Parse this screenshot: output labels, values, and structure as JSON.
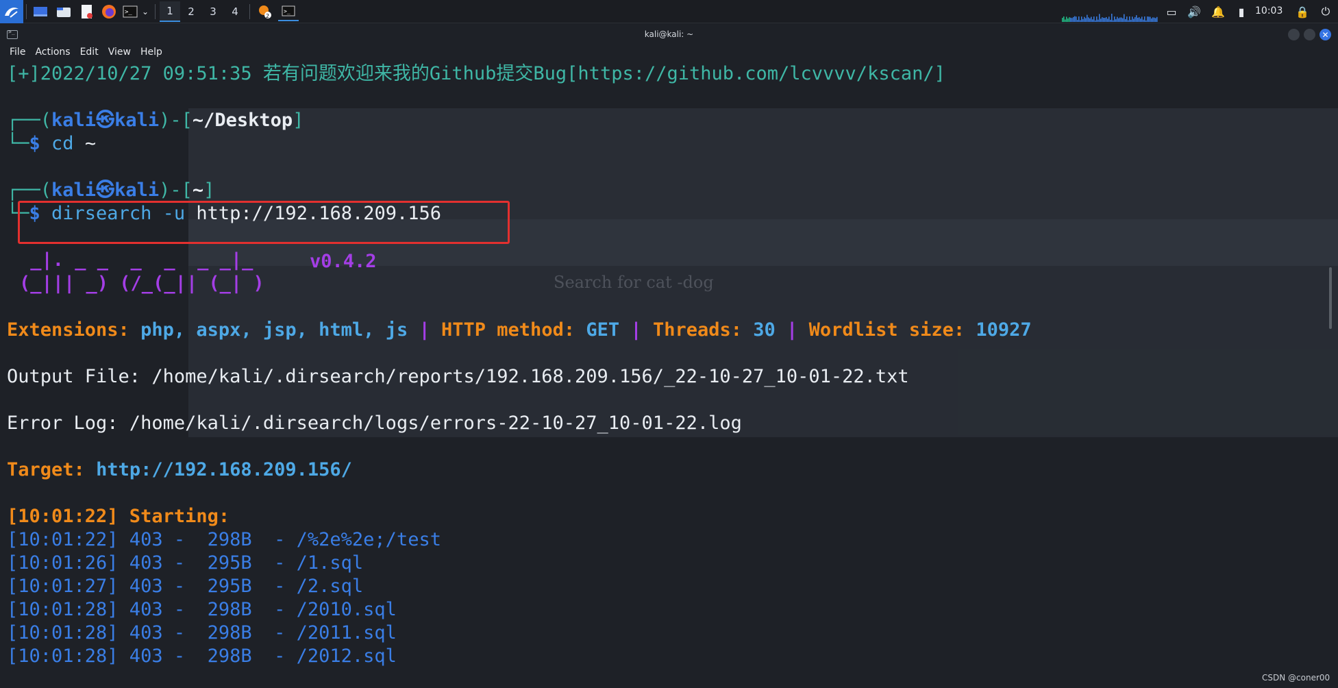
{
  "taskbar": {
    "workspaces": [
      "1",
      "2",
      "3",
      "4"
    ],
    "active_workspace": "1",
    "clock": "10:03",
    "notif_badge": "2"
  },
  "window": {
    "title": "kali@kali: ~"
  },
  "menu": [
    "File",
    "Actions",
    "Edit",
    "View",
    "Help"
  ],
  "ghost_browser": {
    "search_heading": "Search for cat -dog"
  },
  "terminal": {
    "line1": "[+]2022/10/27 09:51:35 若有问题欢迎来我的Github提交Bug[https://github.com/lcvvvv/kscan/]",
    "prompt1": {
      "user": "kali",
      "host": "kali",
      "dir": "~/Desktop",
      "cmd": "cd",
      "arg": "~"
    },
    "prompt2": {
      "user": "kali",
      "host": "kali",
      "dir": "~",
      "cmd": "dirsearch",
      "flag": "-u",
      "arg": "http://192.168.209.156"
    },
    "ascii_art": [
      " _|. _ _  _  _  _ _|_",
      "(_||| _) (/_(_|| (_| )"
    ],
    "version": "v0.4.2",
    "config": {
      "extensions_label": "Extensions:",
      "extensions_value": "php, aspx, jsp, html, js",
      "method_label": "HTTP method:",
      "method_value": "GET",
      "threads_label": "Threads:",
      "threads_value": "30",
      "wordlist_label": "Wordlist size:",
      "wordlist_value": "10927",
      "sep": "|"
    },
    "output_file": "Output File: /home/kali/.dirsearch/reports/192.168.209.156/_22-10-27_10-01-22.txt",
    "error_log": "Error Log: /home/kali/.dirsearch/logs/errors-22-10-27_10-01-22.log",
    "target_label": "Target:",
    "target_value": "http://192.168.209.156/",
    "starting": "[10:01:22] Starting:",
    "results": [
      "[10:01:22] 403 -  298B  - /%2e%2e;/test",
      "[10:01:26] 403 -  295B  - /1.sql",
      "[10:01:27] 403 -  295B  - /2.sql",
      "[10:01:28] 403 -  298B  - /2010.sql",
      "[10:01:28] 403 -  298B  - /2011.sql",
      "[10:01:28] 403 -  298B  - /2012.sql"
    ]
  },
  "watermark": "CSDN @coner00"
}
